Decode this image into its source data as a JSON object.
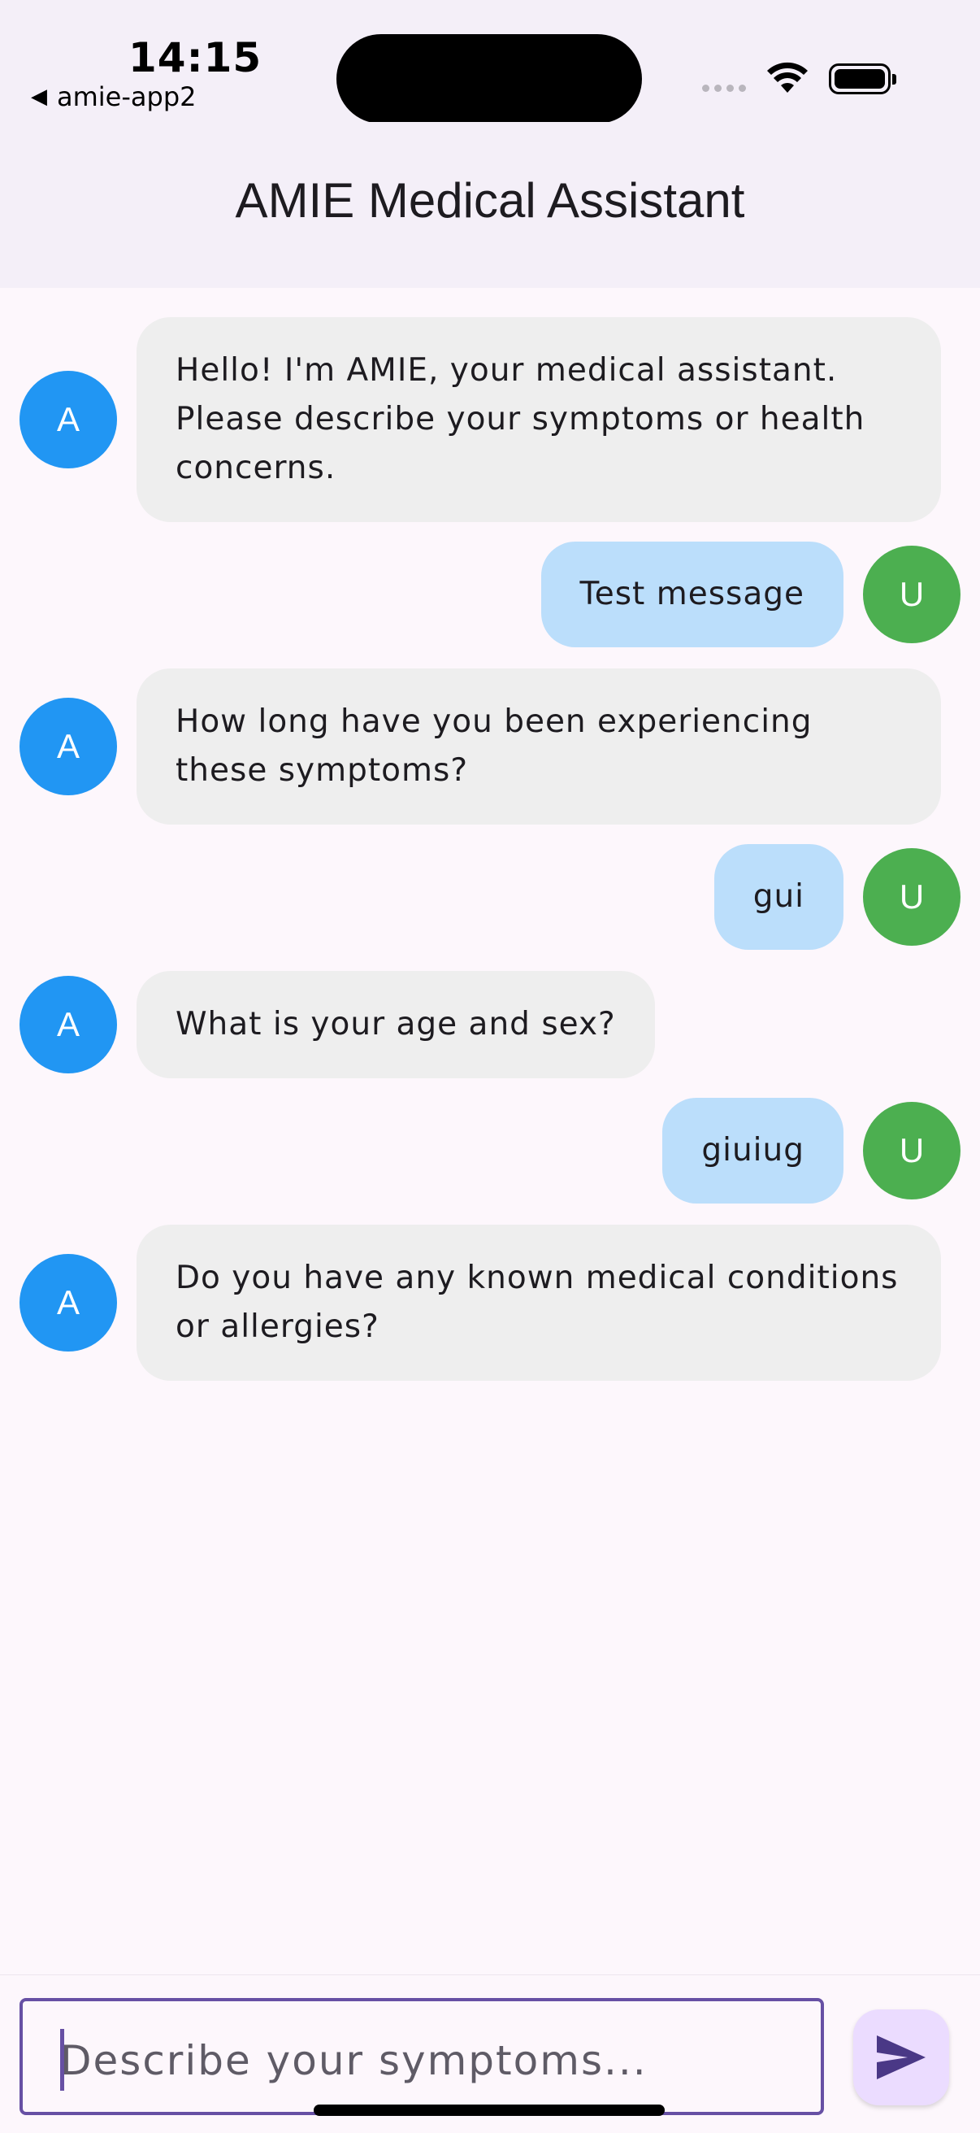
{
  "status_bar": {
    "time": "14:15",
    "back_app": "amie-app2"
  },
  "app_bar": {
    "title": "AMIE Medical Assistant"
  },
  "messages": [
    {
      "sender": "assistant",
      "avatar": "A",
      "text": "Hello! I'm AMIE, your medical assistant. Please describe your symptoms or health concerns."
    },
    {
      "sender": "user",
      "avatar": "U",
      "text": "Test message"
    },
    {
      "sender": "assistant",
      "avatar": "A",
      "text": "How long have you been experiencing these symptoms?"
    },
    {
      "sender": "user",
      "avatar": "U",
      "text": "gui"
    },
    {
      "sender": "assistant",
      "avatar": "A",
      "text": "What is your age and sex?"
    },
    {
      "sender": "user",
      "avatar": "U",
      "text": "giuiug"
    },
    {
      "sender": "assistant",
      "avatar": "A",
      "text": "Do you have any known medical conditions or allergies?"
    }
  ],
  "composer": {
    "placeholder": "Describe your symptoms...",
    "value": "",
    "send_icon": "send-icon"
  },
  "colors": {
    "assistant_avatar": "#2196f3",
    "user_avatar": "#4caf50",
    "assistant_bubble": "#eeeeee",
    "user_bubble": "#bbdefb",
    "accent": "#6750a4"
  }
}
